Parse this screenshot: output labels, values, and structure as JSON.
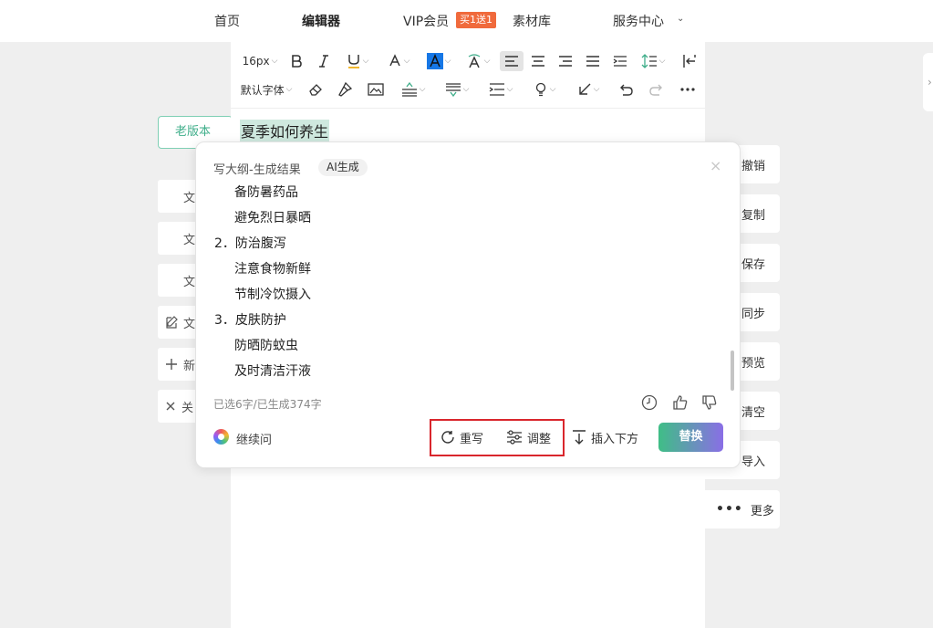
{
  "nav": {
    "home": "首页",
    "editor": "编辑器",
    "vip": "VIP会员",
    "vip_badge": "买1送1",
    "materials": "素材库",
    "service": "服务中心"
  },
  "toolbar": {
    "font_size": "16px",
    "font_family": "默认字体"
  },
  "document": {
    "title": "夏季如何养生"
  },
  "left_panel": {
    "old_version": "老版本",
    "items": [
      "文",
      "文",
      "文",
      "文",
      "新",
      "关"
    ]
  },
  "right_panel": {
    "undo": "撤销",
    "copy": "复制",
    "save": "保存",
    "sync": "同步",
    "preview": "预览",
    "clear": "清空",
    "import": "导入",
    "more": "更多"
  },
  "popup": {
    "title": "写大纲-生成结果",
    "badge": "AI生成",
    "close": "×",
    "outline": [
      {
        "text": "备防暑药品",
        "level": 2
      },
      {
        "text": "避免烈日暴晒",
        "level": 2
      },
      {
        "text": "2．防治腹泻",
        "level": 1
      },
      {
        "text": "注意食物新鲜",
        "level": 2
      },
      {
        "text": "节制冷饮摄入",
        "level": 2
      },
      {
        "text": "3．皮肤防护",
        "level": 1
      },
      {
        "text": "防晒防蚊虫",
        "level": 2
      },
      {
        "text": "及时清洁汗液",
        "level": 2
      }
    ],
    "count_text": "已选6字/已生成374字",
    "ask": "继续问",
    "rewrite": "重写",
    "adjust": "调整",
    "insert_below": "插入下方",
    "replace": "替换"
  }
}
